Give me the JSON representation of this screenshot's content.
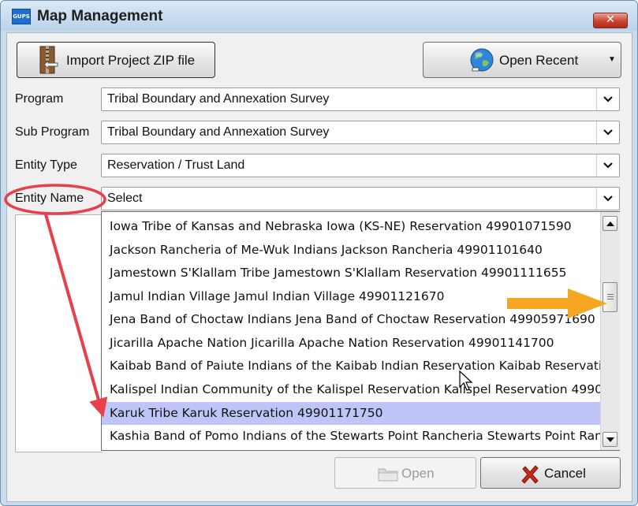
{
  "window": {
    "title": "Map Management",
    "app_icon_text": "GUPS",
    "close_glyph": "✕"
  },
  "toolbar": {
    "import_label": "Import Project ZIP file",
    "recent_label": "Open Recent",
    "recent_caret": "▼"
  },
  "form": {
    "program_label": "Program",
    "program_value": "Tribal Boundary and Annexation Survey",
    "subprogram_label": "Sub Program",
    "subprogram_value": "Tribal Boundary and Annexation Survey",
    "entity_type_label": "Entity Type",
    "entity_type_value": "Reservation / Trust Land",
    "entity_name_label": "Entity Name",
    "entity_name_value": "Select"
  },
  "dropdown": {
    "items": [
      "Iowa Tribe of Kansas and Nebraska Iowa (KS-NE) Reservation 49901071590",
      "Jackson Rancheria of Me-Wuk Indians Jackson Rancheria 49901101640",
      "Jamestown S'Klallam Tribe Jamestown S'Klallam Reservation 49901111655",
      "Jamul Indian Village Jamul Indian Village 49901121670",
      "Jena Band of Choctaw Indians Jena Band of Choctaw Reservation 49905971690",
      "Jicarilla Apache Nation Jicarilla Apache Nation Reservation 49901141700",
      "Kaibab Band of Paiute Indians of the Kaibab Indian Reservation Kaibab Reservation",
      "Kalispel Indian Community of the Kalispel Reservation Kalispel Reservation 4990",
      "Karuk Tribe Karuk Reservation 49901171750",
      "Kashia Band of Pomo Indians of the Stewarts Point Rancheria Stewarts Point Rancheria"
    ],
    "selected_index": 8,
    "scroll_position": 0.3
  },
  "footer": {
    "open_label": "Open",
    "cancel_label": "Cancel"
  },
  "colors": {
    "selected_row": "#bfc6f7",
    "annotation_red": "#e8404a",
    "annotation_orange": "#f5a623"
  },
  "icons": {
    "app": "gups-app-icon",
    "import": "zip-file-icon",
    "recent": "globe-icon",
    "open": "folder-icon",
    "cancel": "red-x-icon",
    "cursor": "mouse-pointer-icon"
  }
}
